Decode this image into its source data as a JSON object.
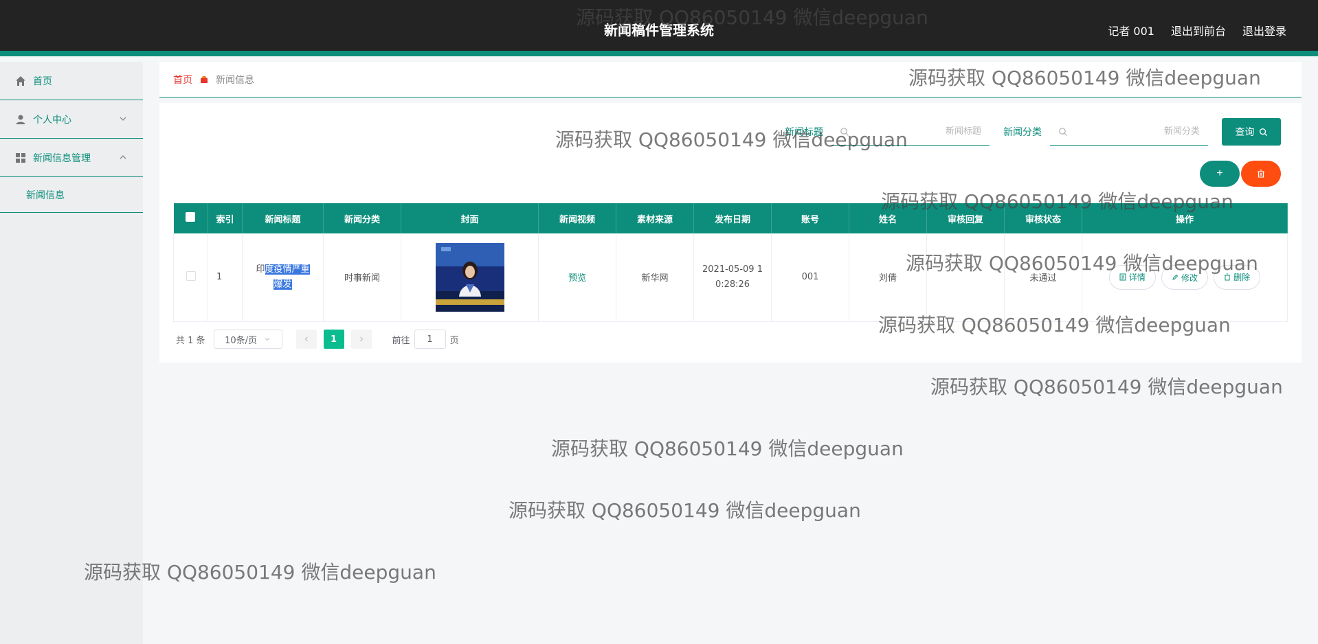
{
  "header": {
    "title": "新闻稿件管理系统",
    "user": "记者 001",
    "to_front": "退出到前台",
    "logout": "退出登录"
  },
  "sidebar": {
    "items": [
      {
        "label": "首页",
        "icon": "home-icon"
      },
      {
        "label": "个人中心",
        "icon": "user-icon"
      },
      {
        "label": "新闻信息管理",
        "icon": "grid-icon"
      }
    ],
    "sub_item": "新闻信息"
  },
  "breadcrumb": {
    "home": "首页",
    "current": "新闻信息"
  },
  "search": {
    "title_label": "新闻标题",
    "title_placeholder": "新闻标题",
    "category_label": "新闻分类",
    "category_placeholder": "新闻分类",
    "query_label": "查询"
  },
  "actions": {
    "add": "+"
  },
  "table": {
    "headers": [
      "索引",
      "新闻标题",
      "新闻分类",
      "封面",
      "新闻视频",
      "素材来源",
      "发布日期",
      "账号",
      "姓名",
      "审核回复",
      "审核状态",
      "操作"
    ],
    "rows": [
      {
        "index": "1",
        "title_pre": "印",
        "title_hl1": "度疫情严重",
        "title_hl2": "爆发",
        "category": "时事新闻",
        "video": "预览",
        "source": "新华网",
        "date_line1": "2021-05-09 1",
        "date_line2": "0:28:26",
        "account": "001",
        "name": "刘倩",
        "reply": "",
        "status": "未通过",
        "op_detail": "详情",
        "op_edit": "修改",
        "op_delete": "删除"
      }
    ]
  },
  "pager": {
    "total": "共 1 条",
    "page_size": "10条/页",
    "current_page": "1",
    "goto_prefix": "前往",
    "goto_value": "1",
    "goto_suffix": "页"
  },
  "watermark": "源码获取 QQ86050149 微信deepguan",
  "colors": {
    "primary": "#0d8e7c",
    "danger": "#ff4d0f",
    "header": "#232323",
    "breadcrumb_home": "#e6352e",
    "page_active": "#0bbd8e"
  }
}
